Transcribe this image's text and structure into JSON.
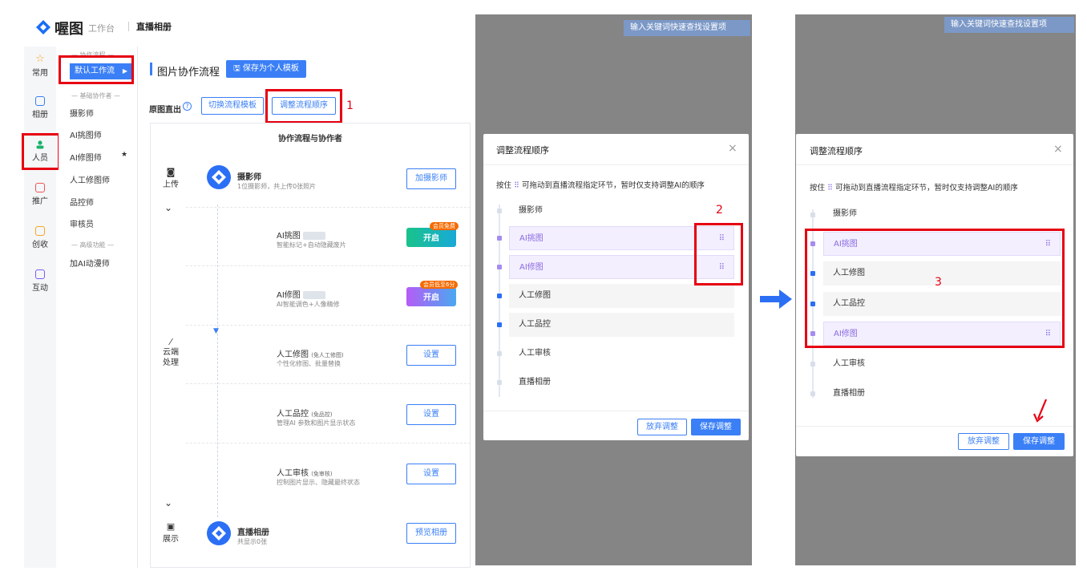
{
  "brand": {
    "name": "喔图",
    "workspace": "工作台",
    "breadcrumb": "直播相册"
  },
  "left_nav": [
    {
      "label": "常用",
      "icon": "star-icon"
    },
    {
      "label": "相册",
      "icon": "album-icon"
    },
    {
      "label": "人员",
      "icon": "person-icon",
      "badge": "AI"
    },
    {
      "label": "推广",
      "icon": "promotion-icon"
    },
    {
      "label": "创收",
      "icon": "revenue-icon"
    },
    {
      "label": "互动",
      "icon": "interaction-icon"
    }
  ],
  "sub_nav": {
    "group1": "— 协作流程 —",
    "active": "默认工作流",
    "group2": "— 基础协作者 —",
    "items": [
      "摄影师",
      "AI挑图师",
      "AI修图师",
      "人工修图师",
      "品控师",
      "审核员"
    ],
    "group3": "— 高级功能 —",
    "advanced": "加AI动漫师"
  },
  "page": {
    "title": "图片协作流程",
    "save_template": "保存为个人模板",
    "mode_label": "原图直出",
    "switch_template": "切换流程模板",
    "adjust_order": "调整流程顺序",
    "card_title": "协作流程与协作者"
  },
  "flow": {
    "upload_label": "上传",
    "cloud_label": "云端处理",
    "show_label": "展示",
    "photographer": {
      "title": "摄影师",
      "sub": "1位摄影师，共上传0张照片",
      "btn": "加摄影师"
    },
    "ai_pick": {
      "title": "AI挑图",
      "sub": "智能标记+自动隐藏废片",
      "btn": "开启",
      "tag": "会员免费"
    },
    "ai_retouch": {
      "title": "AI修图",
      "sub": "AI智能调色+人像精修",
      "btn": "开启",
      "tag": "会员低至6分"
    },
    "manual_retouch": {
      "title": "人工修图",
      "note": "(免人工修图)",
      "sub": "个性化修图、批量替换",
      "btn": "设置"
    },
    "manual_qc": {
      "title": "人工品控",
      "note": "(免品控)",
      "sub": "管理AI 参数和图片显示状态",
      "btn": "设置"
    },
    "manual_review": {
      "title": "人工审核",
      "note": "(免审核)",
      "sub": "控制图片显示、隐藏最终状态",
      "btn": "设置"
    },
    "album": {
      "title": "直播相册",
      "sub": "共显示0张",
      "btn": "预览相册"
    }
  },
  "annotations": {
    "n1": "1",
    "n2": "2",
    "n3": "3"
  },
  "search_placeholder": "输入关键词快速查找设置项",
  "modal": {
    "title": "调整流程顺序",
    "hint_pre": "按住",
    "hint_post": "可拖动到直播流程指定环节，暂时仅支持调整AI的顺序",
    "before": [
      "摄影师",
      "AI挑图",
      "AI修图",
      "人工修图",
      "人工品控",
      "人工审核",
      "直播相册"
    ],
    "after": [
      "摄影师",
      "AI挑图",
      "人工修图",
      "人工品控",
      "AI修图",
      "人工审核",
      "直播相册"
    ],
    "cancel": "放弃调整",
    "save": "保存调整"
  },
  "colors": {
    "primary": "#3a7ff6",
    "annotation": "#e60012",
    "ai_purple": "#8a6bdf",
    "overlay": "#858585"
  }
}
